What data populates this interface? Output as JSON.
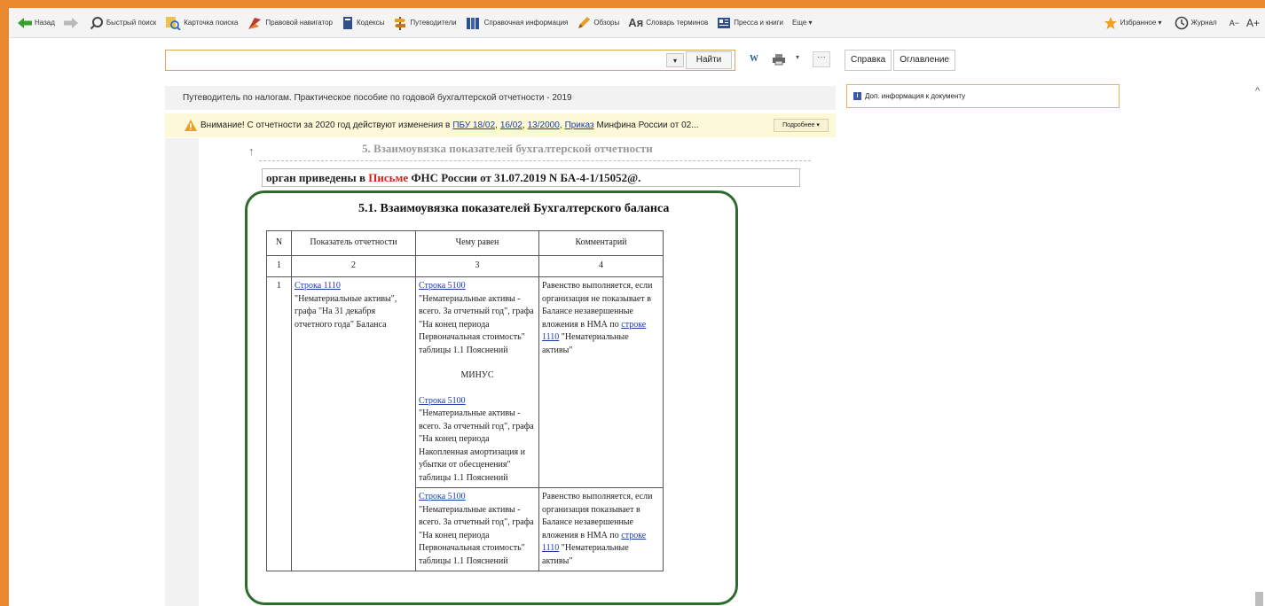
{
  "toolbar": {
    "back": "Назад",
    "quick_search": "Быстрый поиск",
    "search_card": "Карточка поиска",
    "legal_navigator": "Правовой навигатор",
    "codes": "Кодексы",
    "guides": "Путеводители",
    "reference": "Справочная информация",
    "reviews": "Обзоры",
    "glossary_icon": "Ая",
    "glossary": "Словарь терминов",
    "press": "Пресса и книги",
    "more": "Еще ▾",
    "favorites": "Избранное ▾",
    "journal": "Журнал",
    "font_minus": "А−",
    "font_plus": "А+"
  },
  "search": {
    "value": "",
    "dropdown": "▾",
    "find_button": "Найти",
    "word_button": "W",
    "more_button": "···"
  },
  "right_panel": {
    "tab_help": "Справка",
    "tab_contents": "Оглавление",
    "info_icon": "i",
    "info_label": "Доп. информация к документу"
  },
  "document": {
    "title": "Путеводитель по налогам. Практическое пособие по годовой бухгалтерской отчетности - 2019",
    "warning": {
      "text": "Внимание! С отчетности за 2020 год действуют изменения в",
      "link_1": "ПБУ 18/02",
      "link_2": "16/02",
      "link_3": "13/2000",
      "link_4": "Приказ",
      "tail": "Минфина России от 02...",
      "more_button": "Подробнее ▾"
    },
    "up_arrow": "↑",
    "section_heading": "5. Взаимоувязка показателей бухгалтерской отчетности",
    "quote": {
      "before": "орган приведены в",
      "highlight": "Письме",
      "after": "ФНС России от 31.07.2019 N БА-4-1/15052@."
    },
    "subsection_heading": "5.1. Взаимоувязка показателей Бухгалтерского баланса",
    "table": {
      "headers": [
        "N",
        "Показатель отчетности",
        "Чему равен",
        "Комментарий"
      ],
      "numbers": [
        "1",
        "2",
        "3",
        "4"
      ],
      "row1": {
        "n": "1",
        "indicator_link": "Строка 1110",
        "indicator_text": "\"Нематериальные активы\", графа \"На 31 декабря отчетного года\" Баланса",
        "equals_link_a": "Строка 5100",
        "equals_text_a": "\"Нематериальные активы - всего. За отчетный год\", графа \"На конец периода Первоначальная стоимость\" таблицы 1.1 Пояснений",
        "minus": "МИНУС",
        "equals_link_b": "Строка 5100",
        "equals_text_b": "\"Нематериальные активы - всего. За отчетный год\", графа \"На конец периода Накопленная амортизация и убытки от обесценения\" таблицы 1.1 Пояснений",
        "comment_text": "Равенство выполняется, если организация не показывает в Балансе незавершенные вложения в НМА по",
        "comment_link": "строке 1110",
        "comment_tail": "\"Нематериальные активы\""
      },
      "row2": {
        "equals_link": "Строка 5100",
        "equals_text": "\"Нематериальные активы - всего. За отчетный год\", графа \"На конец периода Первоначальная стоимость\" таблицы 1.1 Пояснений",
        "comment_text": "Равенство выполняется, если организация показывает в Балансе незавершенные вложения в НМА по",
        "comment_link": "строке 1110",
        "comment_tail": "\"Нематериальные активы\""
      }
    }
  },
  "scroll": {
    "up": "^"
  },
  "colors": {
    "accent": "#e8892f",
    "frame_green": "#2f6b2f",
    "link": "#1a3da8"
  }
}
